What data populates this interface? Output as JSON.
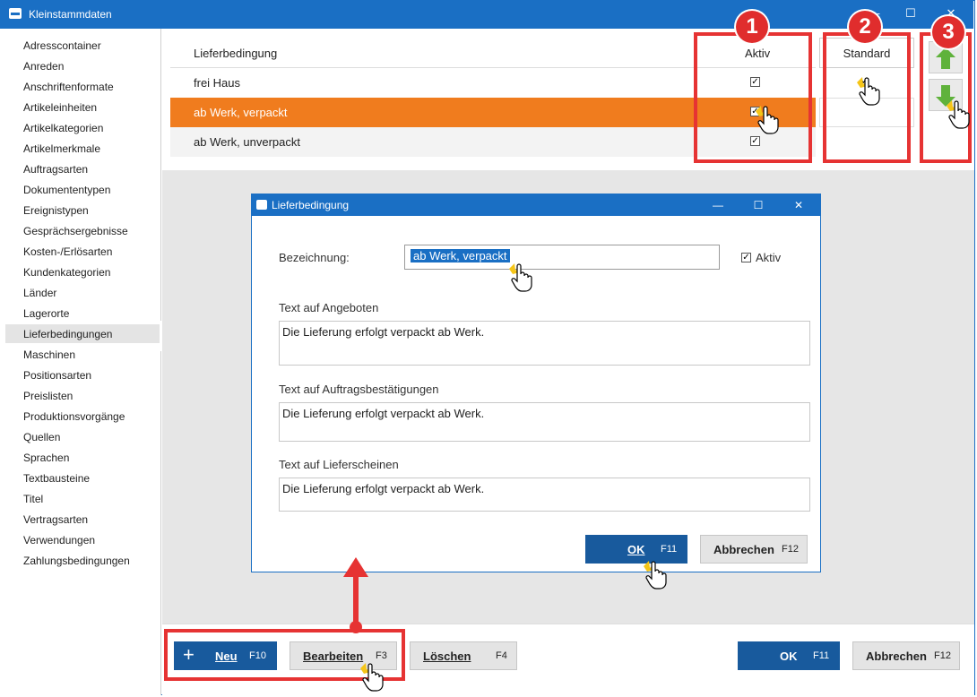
{
  "window": {
    "title": "Kleinstammdaten",
    "minimize": "—",
    "maximize": "☐",
    "close": "✕"
  },
  "sidebar": {
    "items": [
      "Adresscontainer",
      "Anreden",
      "Anschriftenformate",
      "Artikeleinheiten",
      "Artikelkategorien",
      "Artikelmerkmale",
      "Auftragsarten",
      "Dokumententypen",
      "Ereignistypen",
      "Gesprächsergebnisse",
      "Kosten-/Erlösarten",
      "Kundenkategorien",
      "Länder",
      "Lagerorte",
      "Lieferbedingungen",
      "Maschinen",
      "Positionsarten",
      "Preislisten",
      "Produktionsvorgänge",
      "Quellen",
      "Sprachen",
      "Textbausteine",
      "Titel",
      "Vertragsarten",
      "Verwendungen",
      "Zahlungsbedingungen"
    ],
    "selected": "Lieferbedingungen"
  },
  "grid": {
    "columns": {
      "label": "Lieferbedingung",
      "aktiv": "Aktiv",
      "standard": "Standard"
    },
    "rows": [
      {
        "label": "frei Haus",
        "aktiv": "✓"
      },
      {
        "label": "ab Werk, verpackt",
        "aktiv": "✓"
      },
      {
        "label": "ab Werk, unverpackt",
        "aktiv": "✓"
      }
    ],
    "standard_mark": "✓"
  },
  "dialog": {
    "title": "Lieferbedingung",
    "bezeichnung_label": "Bezeichnung:",
    "bezeichnung_value": "ab Werk, verpackt",
    "aktiv_label": "Aktiv",
    "aktiv_check": "✓",
    "angebote_label": "Text auf Angeboten",
    "angebote_text": "Die Lieferung erfolgt verpackt ab Werk.",
    "auftrag_label": "Text auf Auftragsbestätigungen",
    "auftrag_text": "Die Lieferung erfolgt verpackt ab Werk.",
    "lieferschein_label": "Text auf Lieferscheinen",
    "lieferschein_text": "Die Lieferung erfolgt verpackt ab Werk.",
    "ok_label": "OK",
    "ok_key": "F11",
    "cancel_label": "Abbrechen",
    "cancel_key": "F12"
  },
  "toolbar": {
    "new_icon": "+",
    "new_label": "Neu",
    "new_key": "F10",
    "edit_label": "Bearbeiten",
    "edit_key": "F3",
    "delete_label": "Löschen",
    "delete_key": "F4",
    "ok_label": "OK",
    "ok_key": "F11",
    "cancel_label": "Abbrechen",
    "cancel_key": "F12"
  },
  "annotations": {
    "badge1": "1",
    "badge2": "2",
    "badge3": "3"
  },
  "colors": {
    "titlebar": "#1a6fc4",
    "selected_row": "#f07c1e",
    "annotation_red": "#e63333",
    "primary_button": "#185a9d"
  }
}
